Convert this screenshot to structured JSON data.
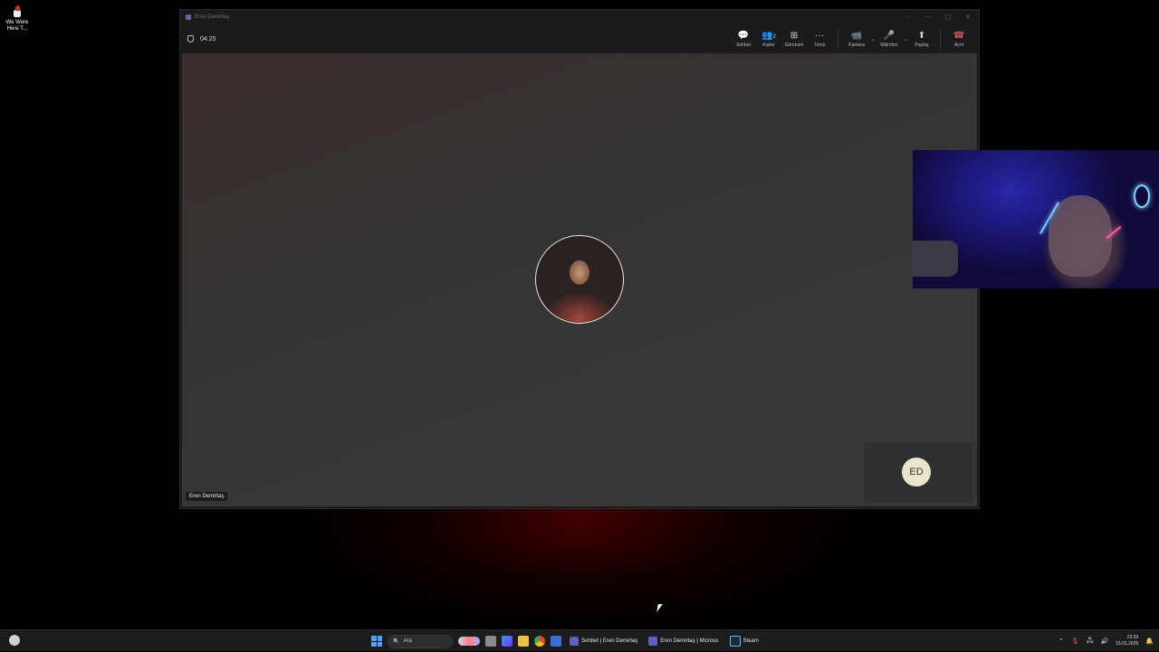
{
  "desktop": {
    "icon_label": "We Were Here T..."
  },
  "window": {
    "title": "Eren Demirtaş",
    "controls": {
      "more": "···",
      "minimize": "–",
      "maximize": "▢",
      "close": "✕"
    }
  },
  "meeting": {
    "timer": "04:25",
    "tools": [
      {
        "key": "chat",
        "icon": "💬",
        "label": "Sohbet"
      },
      {
        "key": "people",
        "icon": "👥",
        "label": "Kişiler",
        "count": "2"
      },
      {
        "key": "view",
        "icon": "⊞",
        "label": "Görünüm"
      },
      {
        "key": "more",
        "icon": "···",
        "label": "Tümü"
      },
      {
        "key": "camera",
        "icon": "📹",
        "label": "Kamera"
      },
      {
        "key": "mic",
        "icon": "🎤",
        "label": "Mikrofon"
      },
      {
        "key": "share",
        "icon": "⬆",
        "label": "Paylaş"
      },
      {
        "key": "leave",
        "icon": "☎",
        "label": "Ayrıl"
      }
    ],
    "participant_name": "Eren Demirtaş",
    "self_initials": "ED",
    "colors": {
      "leave": "#e0525a",
      "accent": "#6264a7"
    }
  },
  "taskbar": {
    "search_placeholder": "Ara",
    "apps": [
      {
        "label": "Sohbet | Eren Demirtaş",
        "color": "#5b5fc7"
      },
      {
        "label": "Eren Demirtaş | Microso",
        "color": "#5b5fc7"
      },
      {
        "label": "Steam",
        "color": "#1b2838"
      }
    ],
    "time": "23:03",
    "date": "15.01.2026"
  }
}
